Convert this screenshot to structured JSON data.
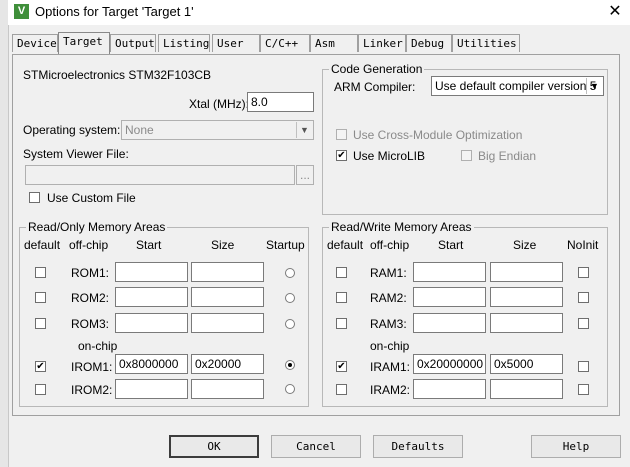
{
  "window": {
    "title": "Options for Target 'Target 1'",
    "app_icon": "V",
    "close_glyph": "✕"
  },
  "tabs": [
    "Device",
    "Target",
    "Output",
    "Listing",
    "User",
    "C/C++",
    "Asm",
    "Linker",
    "Debug",
    "Utilities"
  ],
  "active_tab": "Target",
  "target": {
    "device_name": "STMicroelectronics STM32F103CB",
    "xtal_label": "Xtal (MHz):",
    "xtal_value": "8.0",
    "os_label": "Operating system:",
    "os_value": "None",
    "svf_label": "System Viewer File:",
    "svf_value": "",
    "browse_label": "...",
    "use_custom_file_label": "Use Custom File",
    "use_custom_file_checked": false
  },
  "code_generation": {
    "title": "Code Generation",
    "arm_compiler_label": "ARM Compiler:",
    "arm_compiler_value": "Use default compiler version 5",
    "cross_module_label": "Use Cross-Module Optimization",
    "cross_module_checked": false,
    "microlib_label": "Use MicroLIB",
    "microlib_checked": true,
    "big_endian_label": "Big Endian",
    "big_endian_checked": false
  },
  "ro_memory": {
    "title": "Read/Only Memory Areas",
    "headers": {
      "default": "default",
      "offchip": "off-chip",
      "start": "Start",
      "size": "Size",
      "startup": "Startup"
    },
    "onchip_label": "on-chip",
    "rows": [
      {
        "name": "ROM1:",
        "start": "",
        "size": "",
        "default": false,
        "startup": false
      },
      {
        "name": "ROM2:",
        "start": "",
        "size": "",
        "default": false,
        "startup": false
      },
      {
        "name": "ROM3:",
        "start": "",
        "size": "",
        "default": false,
        "startup": false
      },
      {
        "name": "IROM1:",
        "start": "0x8000000",
        "size": "0x20000",
        "default": true,
        "startup": true
      },
      {
        "name": "IROM2:",
        "start": "",
        "size": "",
        "default": false,
        "startup": false
      }
    ]
  },
  "rw_memory": {
    "title": "Read/Write Memory Areas",
    "headers": {
      "default": "default",
      "offchip": "off-chip",
      "start": "Start",
      "size": "Size",
      "noinit": "NoInit"
    },
    "onchip_label": "on-chip",
    "rows": [
      {
        "name": "RAM1:",
        "start": "",
        "size": "",
        "default": false,
        "noinit": false
      },
      {
        "name": "RAM2:",
        "start": "",
        "size": "",
        "default": false,
        "noinit": false
      },
      {
        "name": "RAM3:",
        "start": "",
        "size": "",
        "default": false,
        "noinit": false
      },
      {
        "name": "IRAM1:",
        "start": "0x20000000",
        "size": "0x5000",
        "default": true,
        "noinit": false
      },
      {
        "name": "IRAM2:",
        "start": "",
        "size": "",
        "default": false,
        "noinit": false
      }
    ]
  },
  "buttons": {
    "ok": "OK",
    "cancel": "Cancel",
    "defaults": "Defaults",
    "help": "Help"
  },
  "glyphs": {
    "check": "✔",
    "dropdown": "▼"
  }
}
